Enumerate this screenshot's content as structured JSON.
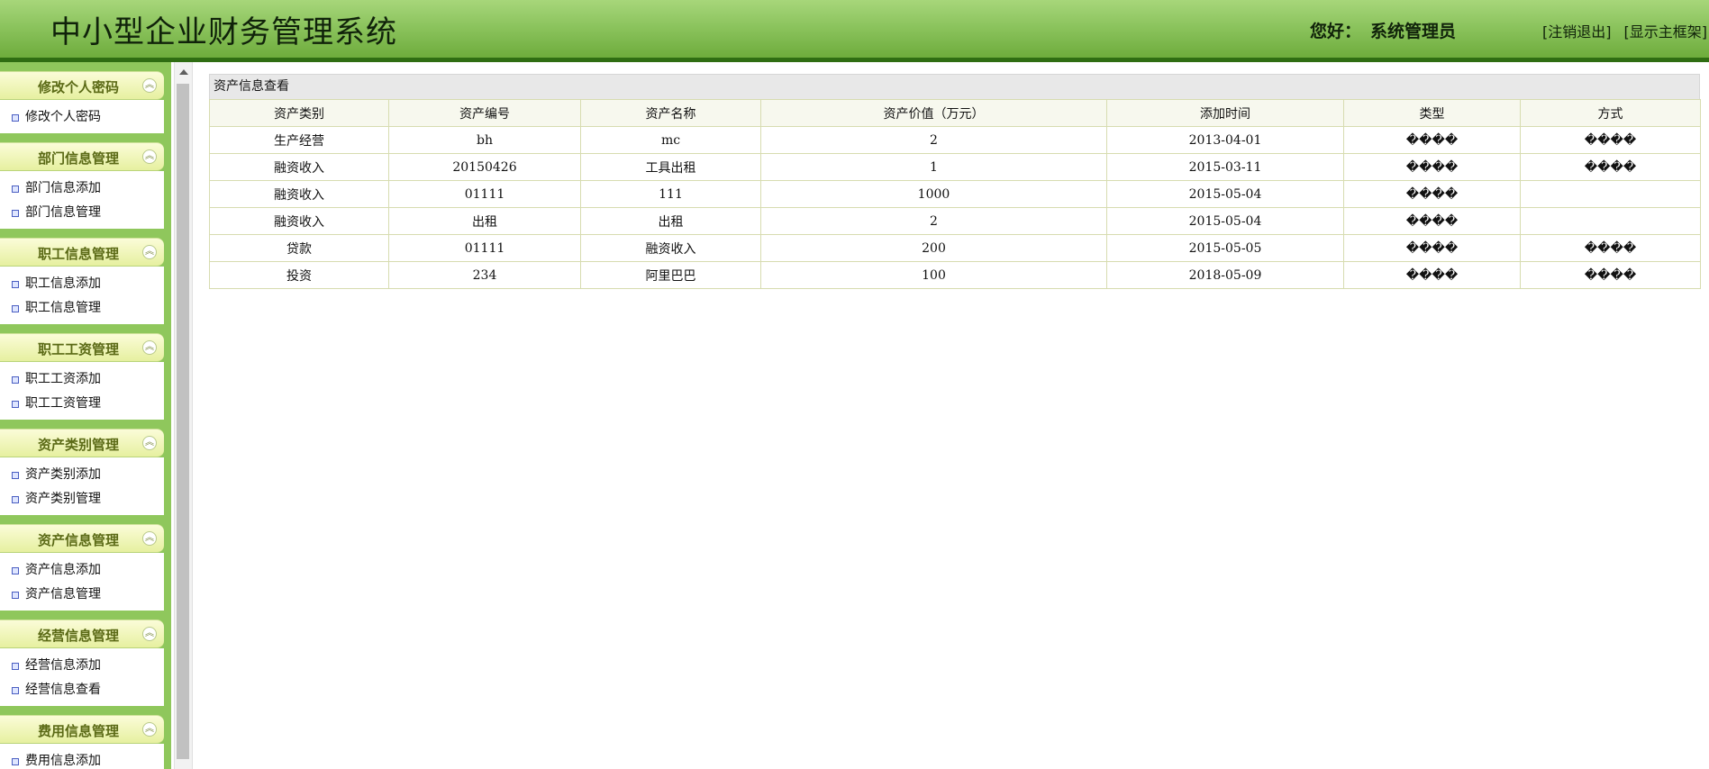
{
  "header": {
    "title": "中小型企业财务管理系统",
    "greeting": "您好：",
    "user": "系统管理员",
    "logout": "[注销退出]",
    "show_main_frame": "[显示主框架]"
  },
  "sidebar": {
    "groups": [
      {
        "title": "修改个人密码",
        "items": [
          "修改个人密码"
        ]
      },
      {
        "title": "部门信息管理",
        "items": [
          "部门信息添加",
          "部门信息管理"
        ]
      },
      {
        "title": "职工信息管理",
        "items": [
          "职工信息添加",
          "职工信息管理"
        ]
      },
      {
        "title": "职工工资管理",
        "items": [
          "职工工资添加",
          "职工工资管理"
        ]
      },
      {
        "title": "资产类别管理",
        "items": [
          "资产类别添加",
          "资产类别管理"
        ]
      },
      {
        "title": "资产信息管理",
        "items": [
          "资产信息添加",
          "资产信息管理"
        ]
      },
      {
        "title": "经营信息管理",
        "items": [
          "经营信息添加",
          "经营信息查看"
        ]
      },
      {
        "title": "费用信息管理",
        "items": [
          "费用信息添加"
        ]
      }
    ],
    "collapse_icon": "double-chevron-up-icon"
  },
  "main": {
    "panel_title": "资产信息查看",
    "columns": [
      "资产类别",
      "资产编号",
      "资产名称",
      "资产价值（万元）",
      "添加时间",
      "类型",
      "方式"
    ],
    "rows": [
      [
        "生产经营",
        "bh",
        "mc",
        "2",
        "2013-04-01",
        "����",
        "����"
      ],
      [
        "融资收入",
        "20150426",
        "工具出租",
        "1",
        "2015-03-11",
        "����",
        "����"
      ],
      [
        "融资收入",
        "01111",
        "111",
        "1000",
        "2015-05-04",
        "����",
        ""
      ],
      [
        "融资收入",
        "出租",
        "出租",
        "2",
        "2015-05-04",
        "����",
        ""
      ],
      [
        "贷款",
        "01111",
        "融资收入",
        "200",
        "2015-05-05",
        "����",
        "����"
      ],
      [
        "投资",
        "234",
        "阿里巴巴",
        "100",
        "2018-05-09",
        "����",
        "����"
      ]
    ]
  },
  "colors": {
    "header_green": "#8cc45e",
    "header_border": "#2f6d12",
    "sidebar_green": "#8fc75c",
    "menu_head": "#e6f0a0",
    "menu_head_text": "#5b6a16",
    "grid_border": "#d7dcb0"
  }
}
